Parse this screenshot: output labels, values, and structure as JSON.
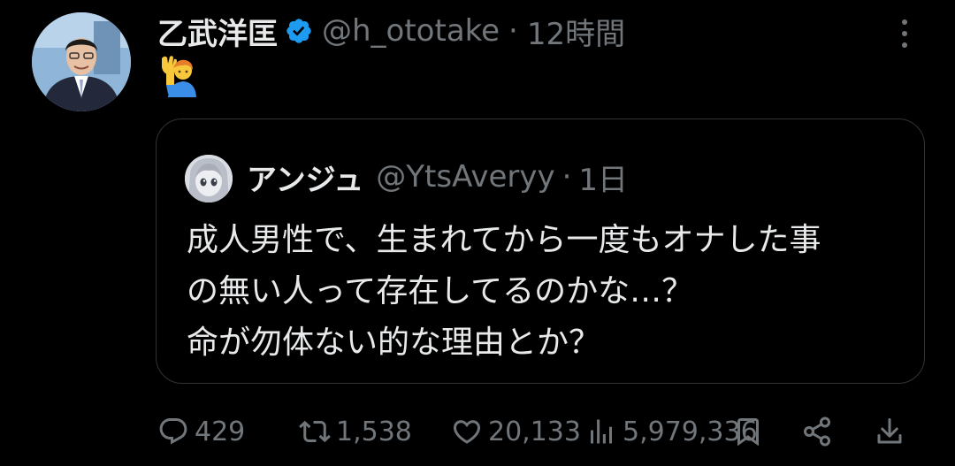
{
  "tweet": {
    "display_name": "乙武洋匡",
    "handle": "@h_ototake",
    "separator": "·",
    "time": "12時間",
    "emoji": "🙋‍♂️",
    "verified": true
  },
  "quoted_tweet": {
    "display_name": "アンジュ",
    "handle": "@YtsAveryy",
    "separator": "·",
    "time": "1日",
    "text_lines": [
      "成人男性で、生まれてから一度もオナした事",
      "の無い人って存在してるのかな…？",
      "命が勿体ない的な理由とか？"
    ]
  },
  "actions": {
    "replies": "429",
    "retweets": "1,538",
    "likes": "20,133",
    "views": "5,979,336"
  },
  "icons": {
    "verified": "verified-badge-icon",
    "more": "more-options-icon",
    "reply": "reply-icon",
    "retweet": "retweet-icon",
    "like": "heart-icon",
    "views": "views-icon",
    "bookmark": "bookmark-icon",
    "share": "share-icon",
    "download": "download-icon"
  },
  "colors": {
    "background": "#000000",
    "primary_text": "#e7e9ea",
    "secondary_text": "#71767b",
    "border": "#2f3336",
    "verified": "#1d9bf0"
  }
}
